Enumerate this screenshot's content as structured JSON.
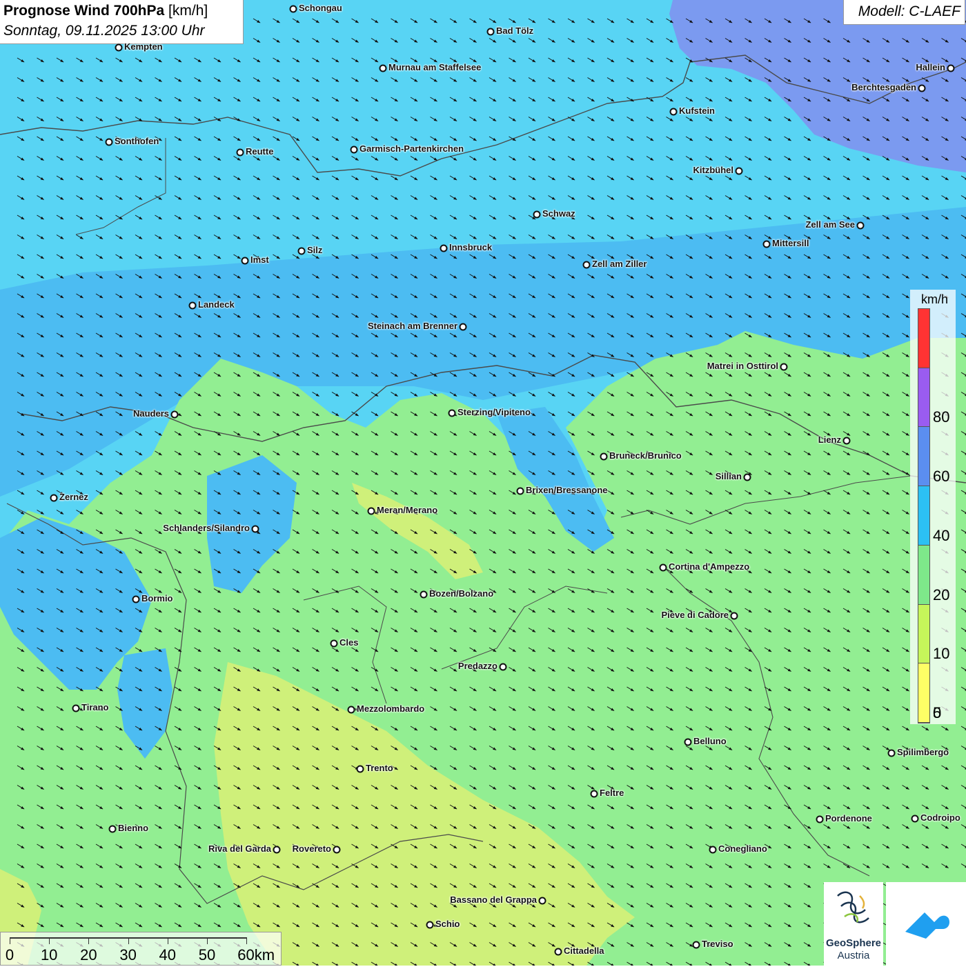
{
  "header": {
    "title_bold": "Prognose Wind 700hPa",
    "title_unit": "[km/h]",
    "subtitle": "Sonntag, 09.11.2025 13:00 Uhr"
  },
  "model": {
    "label": "Modell: C-LAEF"
  },
  "legend": {
    "unit": "km/h",
    "stops": [
      {
        "label": "",
        "color": "#ff3333"
      },
      {
        "label": "80",
        "color": "#9a5cf0"
      },
      {
        "label": "60",
        "color": "#5b8ef0"
      },
      {
        "label": "40",
        "color": "#2cc0f4"
      },
      {
        "label": "20",
        "color": "#7ee88a"
      },
      {
        "label": "10",
        "color": "#c6f55a"
      },
      {
        "label": "5",
        "color": "#fefe66"
      }
    ],
    "bottom_label": "0"
  },
  "scale": {
    "labels": [
      "0",
      "10",
      "20",
      "30",
      "40",
      "50",
      "60km"
    ]
  },
  "logos": {
    "geosphere_line1": "GeoSphere",
    "geosphere_line2": "Austria"
  },
  "colors": {
    "wind_light_blue": "#58d4f4",
    "wind_blue": "#4cbcf2",
    "wind_violet": "#7b9af0",
    "wind_green": "#92ee92",
    "wind_yellowgreen": "#cff07a",
    "brand_blue": "#1f9ff0"
  },
  "cities": [
    {
      "name": "Schongau"
    },
    {
      "name": "Bad Tölz"
    },
    {
      "name": "Kempten"
    },
    {
      "name": "Murnau am Staffelsee"
    },
    {
      "name": "Hallein"
    },
    {
      "name": "Berchtesgaden"
    },
    {
      "name": "Kufstein"
    },
    {
      "name": "Sonthofen"
    },
    {
      "name": "Reutte"
    },
    {
      "name": "Garmisch-Partenkirchen"
    },
    {
      "name": "Kitzbühel"
    },
    {
      "name": "Schwaz"
    },
    {
      "name": "Zell am See"
    },
    {
      "name": "Mittersill"
    },
    {
      "name": "Innsbruck"
    },
    {
      "name": "Silz"
    },
    {
      "name": "Imst"
    },
    {
      "name": "Zell am Ziller"
    },
    {
      "name": "Landeck"
    },
    {
      "name": "Steinach am Brenner"
    },
    {
      "name": "Matrei in Osttirol"
    },
    {
      "name": "Nauders"
    },
    {
      "name": "Sterzing/Vipiteno"
    },
    {
      "name": "Lienz"
    },
    {
      "name": "Bruneck/Brunico"
    },
    {
      "name": "Sillian"
    },
    {
      "name": "Brixen/Bressanone"
    },
    {
      "name": "Zernez"
    },
    {
      "name": "Meran/Merano"
    },
    {
      "name": "Schlanders/Silandro"
    },
    {
      "name": "Cortina d'Ampezzo"
    },
    {
      "name": "Bozen/Bolzano"
    },
    {
      "name": "Bormio"
    },
    {
      "name": "Pieve di Cadore"
    },
    {
      "name": "Cles"
    },
    {
      "name": "Predazzo"
    },
    {
      "name": "Tirano"
    },
    {
      "name": "Mezzolombardo"
    },
    {
      "name": "Belluno"
    },
    {
      "name": "Spilimbergo"
    },
    {
      "name": "Trento"
    },
    {
      "name": "Feltre"
    },
    {
      "name": "Pordenone"
    },
    {
      "name": "Codroipo"
    },
    {
      "name": "Bienno"
    },
    {
      "name": "Riva del Garda"
    },
    {
      "name": "Rovereto"
    },
    {
      "name": "Conegliano"
    },
    {
      "name": "Bassano del Grappa"
    },
    {
      "name": "Schio"
    },
    {
      "name": "Treviso"
    },
    {
      "name": "Cittadella"
    }
  ]
}
